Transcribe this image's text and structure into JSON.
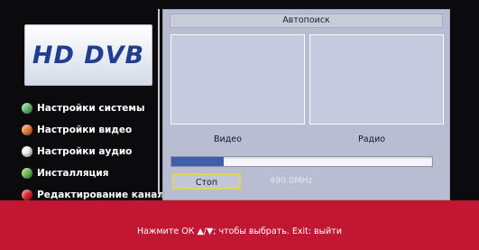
{
  "logo": {
    "text": "HD DVB"
  },
  "menu": {
    "items": [
      {
        "label": "Настройки системы",
        "color": "#5fc06a"
      },
      {
        "label": "Настройки видео",
        "color": "#f07a30"
      },
      {
        "label": "Настройки аудио",
        "color": "#f4f4f4"
      },
      {
        "label": "Инсталляция",
        "color": "#63c04a"
      },
      {
        "label": "Редактирование канал",
        "color": "#e4202a"
      }
    ]
  },
  "dialog": {
    "title": "Автопоиск",
    "video_label": "Видео",
    "radio_label": "Радио",
    "progress_fraction": 0.2,
    "stop_label": "Стоп",
    "frequency": "490.0MHz"
  },
  "footer": {
    "hint": "Нажмите ОК ▲/▼; чтобы выбрать. Exit: выйти"
  }
}
